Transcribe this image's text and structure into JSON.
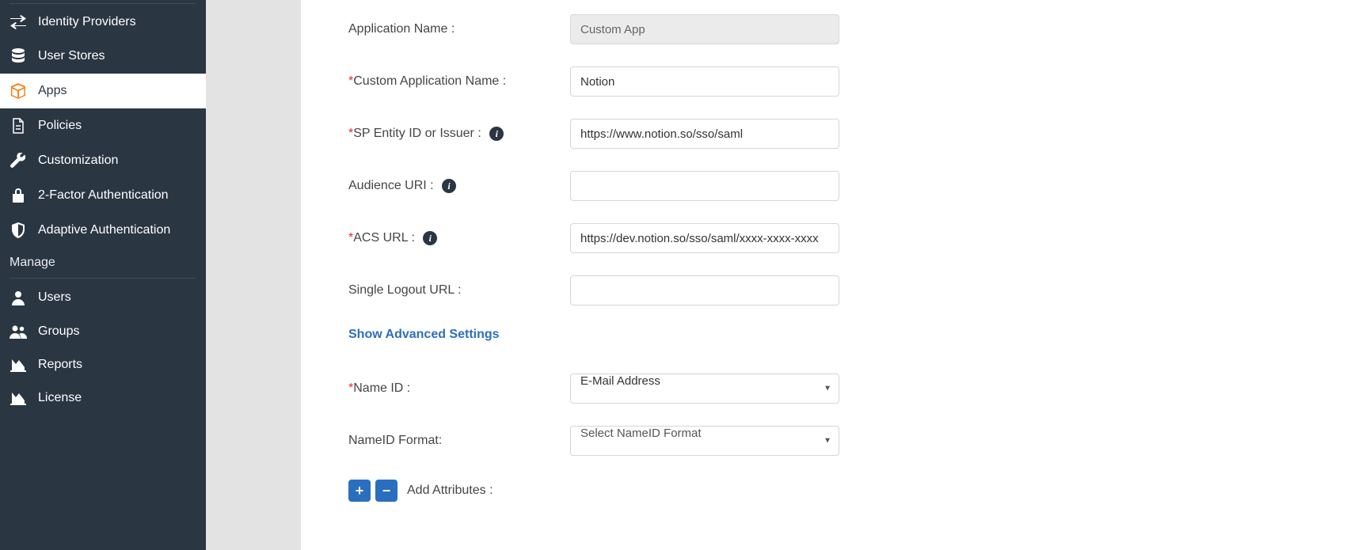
{
  "sidebar": {
    "items": [
      {
        "label": "Identity Providers",
        "icon": "exchange-icon"
      },
      {
        "label": "User Stores",
        "icon": "database-icon"
      },
      {
        "label": "Apps",
        "icon": "box-icon",
        "active": true
      },
      {
        "label": "Policies",
        "icon": "document-icon"
      },
      {
        "label": "Customization",
        "icon": "wrench-icon"
      },
      {
        "label": "2-Factor Authentication",
        "icon": "lock-icon"
      },
      {
        "label": "Adaptive Authentication",
        "icon": "shield-icon"
      }
    ],
    "section_label": "Manage",
    "manage_items": [
      {
        "label": "Users",
        "icon": "user-icon"
      },
      {
        "label": "Groups",
        "icon": "group-icon"
      },
      {
        "label": "Reports",
        "icon": "chart-icon"
      },
      {
        "label": "License",
        "icon": "chart-icon"
      }
    ]
  },
  "form": {
    "app_name_label": "Application Name :",
    "app_name_value": "Custom App",
    "custom_app_label": "Custom Application Name :",
    "custom_app_value": "Notion",
    "sp_entity_label": "SP Entity ID or Issuer :",
    "sp_entity_value": "https://www.notion.so/sso/saml",
    "audience_label": "Audience URI :",
    "audience_value": "",
    "acs_label": "ACS URL :",
    "acs_value": "https://dev.notion.so/sso/saml/xxxx-xxxx-xxxx",
    "slo_label": "Single Logout URL :",
    "slo_value": "",
    "advanced_link": "Show Advanced Settings",
    "nameid_label": "Name ID :",
    "nameid_value": "E-Mail Address",
    "nameid_format_label": "NameID Format:",
    "nameid_format_placeholder": "Select NameID Format",
    "add_attr_label": "Add Attributes :"
  }
}
